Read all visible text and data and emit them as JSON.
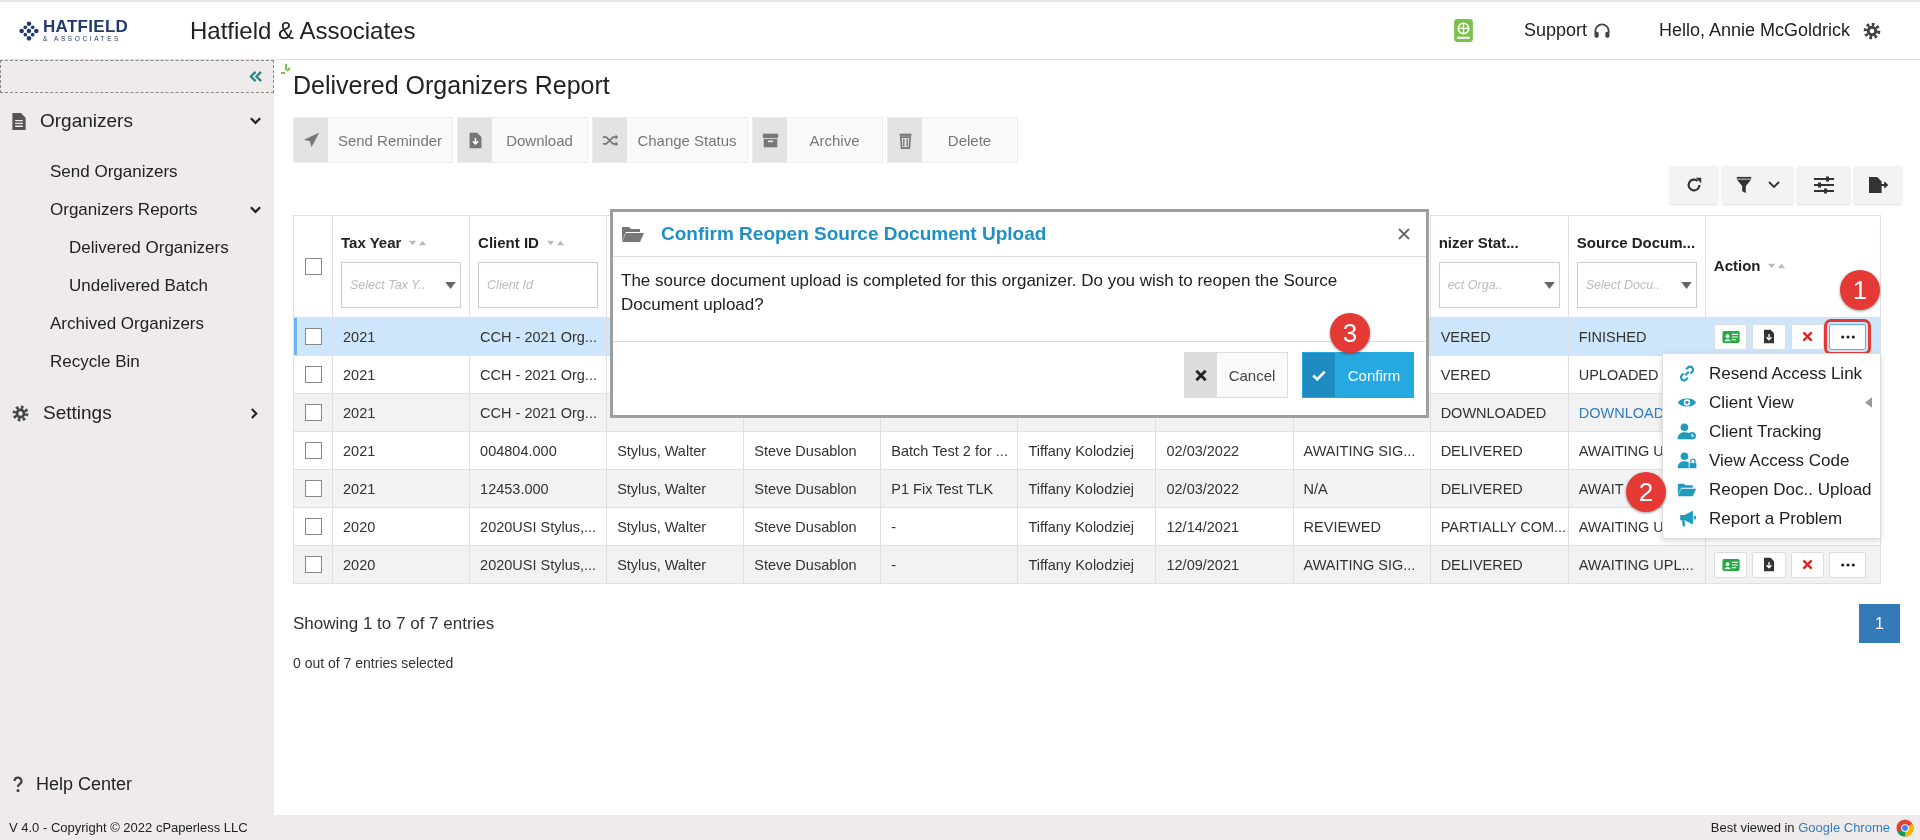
{
  "header": {
    "logo": {
      "name": "HATFIELD",
      "tagline": "& ASSOCIATES"
    },
    "brand": "Hatfield & Associates",
    "support": "Support",
    "greeting": "Hello, Annie McGoldrick"
  },
  "sidebar": {
    "items": [
      {
        "label": "Organizers",
        "kind": "document",
        "expanded": true,
        "children": [
          {
            "label": "Send Organizers"
          },
          {
            "label": "Organizers Reports",
            "expanded": true,
            "children": [
              {
                "label": "Delivered Organizers"
              },
              {
                "label": "Undelivered Batch"
              }
            ]
          },
          {
            "label": "Archived Organizers"
          },
          {
            "label": "Recycle Bin"
          }
        ]
      },
      {
        "label": "Settings",
        "kind": "gear",
        "expanded": false
      }
    ],
    "help": "Help Center"
  },
  "page_title": "Delivered Organizers Report",
  "toolbar": [
    {
      "label": "Send Reminder",
      "kind": "send"
    },
    {
      "label": "Download",
      "kind": "download"
    },
    {
      "label": "Change Status",
      "kind": "shuffle"
    },
    {
      "label": "Archive",
      "kind": "archive"
    },
    {
      "label": "Delete",
      "kind": "trash"
    }
  ],
  "table": {
    "select_all": {
      "checked": false
    },
    "columns": [
      {
        "label": "Tax Year",
        "sortable": true,
        "filter": {
          "kind": "select",
          "placeholder": "Select Tax Y.."
        }
      },
      {
        "label": "Client ID",
        "sortable": true,
        "filter": {
          "kind": "text",
          "placeholder": "Client Id"
        }
      },
      null,
      null,
      null,
      null,
      null,
      null,
      {
        "label": "nizer Stat...",
        "sortable": false,
        "filter": {
          "kind": "select",
          "placeholder": "ect Orga.."
        }
      },
      {
        "label": "Source Docum...",
        "sortable": false,
        "filter": {
          "kind": "select",
          "placeholder": "Select Docu.."
        }
      },
      {
        "label": "Action",
        "sortable": true
      }
    ],
    "rows": [
      {
        "checked": false,
        "highlighted": true,
        "cells": [
          "2021",
          "CCH - 2021 Org...",
          null,
          null,
          null,
          null,
          null,
          null,
          "VERED",
          "FINISHED"
        ],
        "actions": [
          {
            "kind": "card",
            "outlined": false
          },
          {
            "kind": "download",
            "outlined": false
          },
          {
            "kind": "delete",
            "outlined": false
          },
          {
            "kind": "more",
            "outlined": true
          }
        ]
      },
      {
        "checked": false,
        "highlighted": false,
        "cells": [
          "2021",
          "CCH - 2021 Org...",
          null,
          null,
          null,
          null,
          null,
          null,
          "VERED",
          "UPLOADED"
        ]
      },
      {
        "checked": false,
        "highlighted": false,
        "cells": [
          "2021",
          "CCH - 2021 Org...",
          null,
          null,
          null,
          null,
          null,
          null,
          "DOWNLOADED",
          {
            "text": "DOWNLOAD",
            "link": true
          }
        ]
      },
      {
        "checked": false,
        "highlighted": false,
        "cells": [
          "2021",
          "004804.000",
          "Stylus, Walter",
          "Steve Dusablon",
          "Batch Test 2 for ...",
          "Tiffany Kolodziej",
          "02/03/2022",
          "AWAITING SIG...",
          "DELIVERED",
          "AWAITING U"
        ]
      },
      {
        "checked": false,
        "highlighted": false,
        "cells": [
          "2021",
          "12453.000",
          "Stylus, Walter",
          "Steve Dusablon",
          "P1 Fix Test TLK",
          "Tiffany Kolodziej",
          "02/03/2022",
          "N/A",
          "DELIVERED",
          "AWAIT"
        ]
      },
      {
        "checked": false,
        "highlighted": false,
        "cells": [
          "2020",
          "2020USI Stylus,...",
          "Stylus, Walter",
          "Steve Dusablon",
          "-",
          "Tiffany Kolodziej",
          "12/14/2021",
          "REVIEWED",
          "PARTIALLY COM...",
          "AWAITING U"
        ]
      },
      {
        "checked": false,
        "highlighted": false,
        "cells": [
          "2020",
          "2020USI Stylus,...",
          "Stylus, Walter",
          "Steve Dusablon",
          "-",
          "Tiffany Kolodziej",
          "12/09/2021",
          "AWAITING SIG...",
          "DELIVERED",
          "AWAITING UPL..."
        ],
        "actions": [
          {
            "kind": "card",
            "outlined": false
          },
          {
            "kind": "download",
            "outlined": false
          },
          {
            "kind": "delete",
            "outlined": false
          },
          {
            "kind": "more",
            "outlined": false
          }
        ]
      }
    ]
  },
  "entries_info": "Showing 1 to 7 of 7 entries",
  "selection_info": "0 out of 7 entries selected",
  "pagination": [
    {
      "label": "1",
      "selected": true
    }
  ],
  "modal": {
    "title": "Confirm Reopen Source Document Upload",
    "message": "The source document upload is completed for this organizer. Do you wish to reopen the Source Document upload?",
    "buttons": [
      {
        "label": "Cancel",
        "kind": "cancel"
      },
      {
        "label": "Confirm",
        "kind": "confirm"
      }
    ]
  },
  "action_menu": [
    {
      "label": "Resend Access Link",
      "kind": "link",
      "submenu": false
    },
    {
      "label": "Client View",
      "kind": "eye",
      "submenu": true
    },
    {
      "label": "Client Tracking",
      "kind": "user-clock",
      "submenu": false
    },
    {
      "label": "View Access Code",
      "kind": "user-lock",
      "submenu": false
    },
    {
      "label": "Reopen Doc.. Upload",
      "kind": "folder",
      "submenu": false
    },
    {
      "label": "Report a Problem",
      "kind": "bullhorn",
      "submenu": false
    }
  ],
  "annotations": [
    {
      "label": "1"
    },
    {
      "label": "2"
    },
    {
      "label": "3"
    }
  ],
  "footer": {
    "copyright": "V 4.0 - Copyright © 2022 cPaperless LLC",
    "note": "Best viewed in",
    "note_link": "Google Chrome"
  }
}
